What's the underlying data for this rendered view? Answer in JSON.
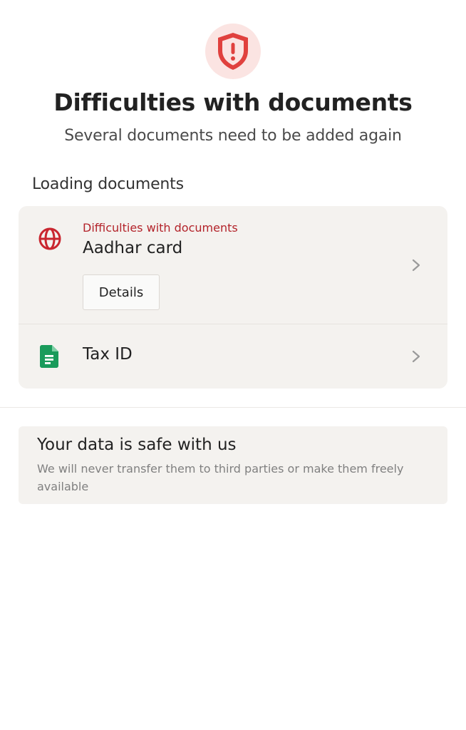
{
  "header": {
    "icon": "shield-alert-icon",
    "title": "Difficulties with documents",
    "subtitle": "Several documents need to be added again"
  },
  "documents_section": {
    "title": "Loading documents",
    "items": [
      {
        "icon": "globe-icon",
        "status": "Difficulties with documents",
        "name": "Aadhar card",
        "action_label": "Details"
      },
      {
        "icon": "document-icon",
        "name": "Tax ID"
      }
    ]
  },
  "safety_notice": {
    "title": "Your data is safe with us",
    "description": "We will never transfer them to third parties or make them freely available"
  },
  "colors": {
    "error": "#b3232a",
    "shield_red": "#e0413e",
    "document_green": "#1a9b5b",
    "card_bg": "#f4f2ef"
  }
}
